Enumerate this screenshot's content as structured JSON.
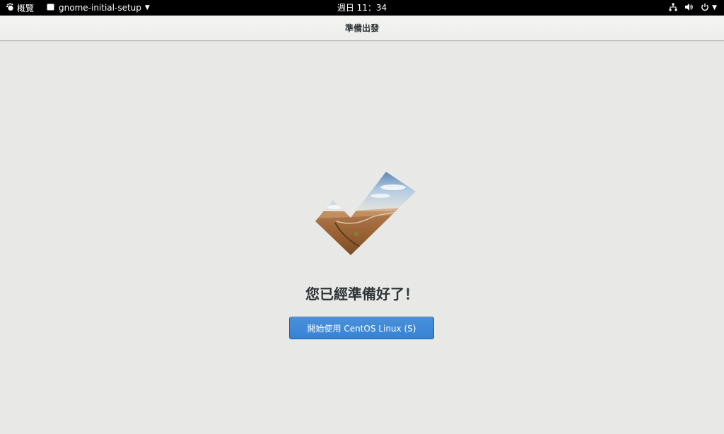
{
  "topbar": {
    "activities_label": "概覽",
    "app_menu_label": "gnome-initial-setup",
    "clock": "週日 11：34",
    "icons": {
      "activities": "gnome-foot-icon",
      "app": "window-icon",
      "network": "network-wired-icon",
      "volume": "volume-icon",
      "power": "power-icon",
      "caret": "chevron-down-icon"
    }
  },
  "window": {
    "title": "準備出發"
  },
  "main": {
    "heading": "您已經準備好了！",
    "start_button_label": "開始使用 CentOS Linux (S)"
  },
  "colors": {
    "background": "#e8e8e7",
    "topbar": "#000000",
    "accent": "#3583d6"
  }
}
